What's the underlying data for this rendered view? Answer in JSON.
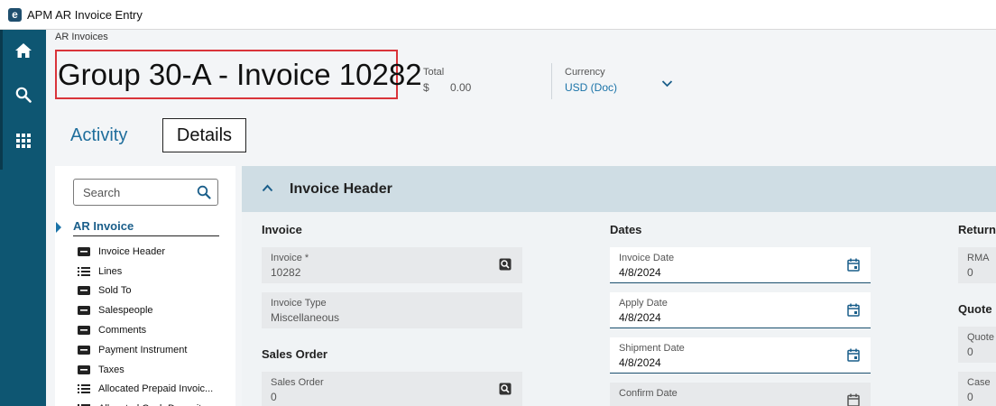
{
  "window": {
    "title": "APM AR Invoice Entry",
    "logo_letter": "e"
  },
  "rail": {
    "items": [
      "home-icon",
      "search-icon",
      "apps-grid-icon"
    ]
  },
  "breadcrumb": "AR Invoices",
  "page_title": "Group 30-A - Invoice 10282",
  "summary": {
    "total_label": "Total",
    "total_symbol": "$",
    "total_value": "0.00",
    "currency_label": "Currency",
    "currency_value": "USD (Doc)"
  },
  "tabs": {
    "activity": "Activity",
    "details": "Details"
  },
  "nav": {
    "search_placeholder": "Search",
    "section": "AR Invoice",
    "items": [
      {
        "label": "Invoice Header",
        "icon": "card-icon"
      },
      {
        "label": "Lines",
        "icon": "list-icon"
      },
      {
        "label": "Sold To",
        "icon": "card-icon"
      },
      {
        "label": "Salespeople",
        "icon": "card-icon"
      },
      {
        "label": "Comments",
        "icon": "card-icon"
      },
      {
        "label": "Payment Instrument",
        "icon": "card-icon"
      },
      {
        "label": "Taxes",
        "icon": "card-icon"
      },
      {
        "label": "Allocated Prepaid Invoic...",
        "icon": "list-icon"
      },
      {
        "label": "Allocated Cash Deposit...",
        "icon": "list-icon"
      }
    ]
  },
  "main": {
    "section_title": "Invoice Header",
    "groups": {
      "invoice": "Invoice",
      "sales_order": "Sales Order",
      "dates": "Dates",
      "return": "Return",
      "quote": "Quote"
    },
    "fields": {
      "invoice_num": {
        "label": "Invoice *",
        "value": "10282"
      },
      "invoice_type": {
        "label": "Invoice Type",
        "value": "Miscellaneous"
      },
      "sales_order": {
        "label": "Sales Order",
        "value": "0"
      },
      "invoice_date": {
        "label": "Invoice Date",
        "value": "4/8/2024"
      },
      "apply_date": {
        "label": "Apply Date",
        "value": "4/8/2024"
      },
      "shipment_date": {
        "label": "Shipment Date",
        "value": "4/8/2024"
      },
      "confirm_date": {
        "label": "Confirm Date",
        "value": ""
      },
      "rma": {
        "label": "RMA",
        "value": "0"
      },
      "quote": {
        "label": "Quote",
        "value": "0"
      },
      "case": {
        "label": "Case",
        "value": "0"
      }
    }
  },
  "colors": {
    "rail": "#0e5672",
    "accent": "#1a73a8",
    "title_highlight": "#d9343a"
  }
}
